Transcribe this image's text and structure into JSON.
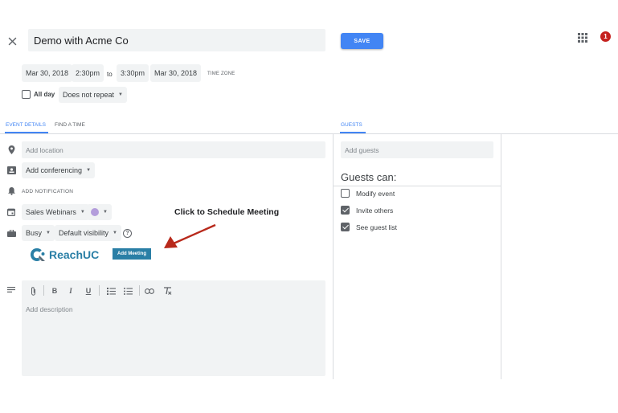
{
  "header": {
    "title": "Demo with Acme Co",
    "save_label": "SAVE",
    "notification_count": "1"
  },
  "datetime": {
    "start_date": "Mar 30, 2018",
    "start_time": "2:30pm",
    "to_label": "to",
    "end_time": "3:30pm",
    "end_date": "Mar 30, 2018",
    "time_zone_label": "TIME ZONE",
    "all_day_label": "All day",
    "repeat_value": "Does not repeat"
  },
  "tabs": {
    "event_details": "EVENT DETAILS",
    "find_a_time": "FIND A TIME",
    "guests": "GUESTS"
  },
  "details": {
    "location_placeholder": "Add location",
    "conferencing_label": "Add conferencing",
    "notification_label": "ADD NOTIFICATION",
    "calendar_value": "Sales Webinars",
    "calendar_color": "#b39ddb",
    "busy_value": "Busy",
    "visibility_value": "Default visibility",
    "description_placeholder": "Add description"
  },
  "plugin": {
    "brand_name": "ReachUC",
    "add_meeting_label": "Add Meeting",
    "annotation": "Click to Schedule Meeting"
  },
  "guests": {
    "add_placeholder": "Add guests",
    "heading": "Guests can:",
    "permissions": [
      {
        "label": "Modify event",
        "checked": false
      },
      {
        "label": "Invite others",
        "checked": true
      },
      {
        "label": "See guest list",
        "checked": true
      }
    ]
  },
  "colors": {
    "accent": "#4285f4",
    "notification_badge": "#c5221f",
    "arrow": "#b8291b",
    "plugin_button": "#2a7fa6",
    "brand": "#2a7fa6"
  }
}
